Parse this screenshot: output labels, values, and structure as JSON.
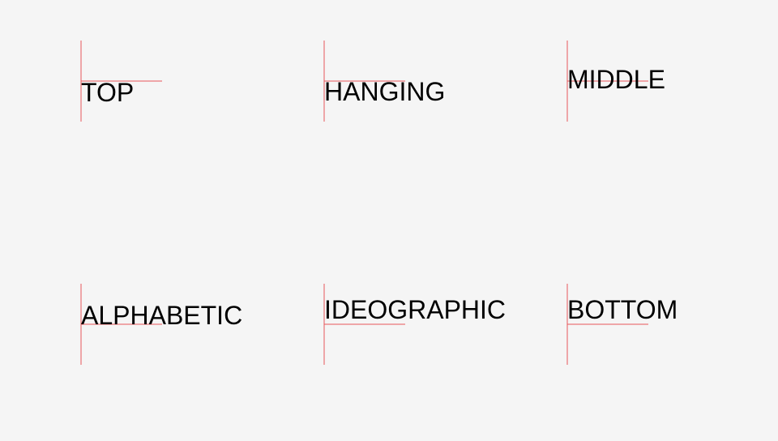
{
  "colors": {
    "background": "#f5f5f5",
    "guide": "#e8575a",
    "text": "#000000"
  },
  "samples": [
    {
      "label": "TOP",
      "baseline": "top"
    },
    {
      "label": "HANGING",
      "baseline": "hanging"
    },
    {
      "label": "MIDDLE",
      "baseline": "middle"
    },
    {
      "label": "ALPHABETIC",
      "baseline": "alphabetic"
    },
    {
      "label": "IDEOGRAPHIC",
      "baseline": "ideographic"
    },
    {
      "label": "BOTTOM",
      "baseline": "bottom"
    }
  ]
}
